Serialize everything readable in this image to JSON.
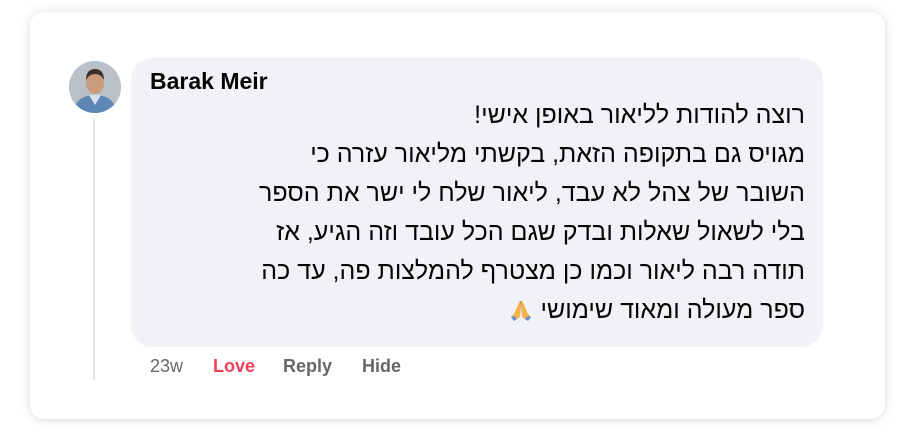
{
  "comment": {
    "author": "Barak Meir",
    "lines": [
      "רוצה להודות לליאור באופן אישי!",
      "מגויס גם בתקופה הזאת, בקשתי מליאור עזרה כי",
      "השובר של צהל לא עבד, ליאור שלח לי ישר את הספר",
      "בלי לשאול שאלות ובדק שגם הכל עובד וזה הגיע, אז",
      "תודה רבה ליאור וכמו כן מצטרף להמלצות פה, עד כה",
      "ספר מעולה ומאוד שימושי"
    ],
    "emoji_icon": "folded-hands-icon"
  },
  "actions": {
    "time": "23w",
    "love": "Love",
    "reply": "Reply",
    "hide": "Hide"
  },
  "colors": {
    "bubble_bg": "#f0f2f5",
    "love": "#f33e58",
    "meta_text": "#65676b"
  }
}
